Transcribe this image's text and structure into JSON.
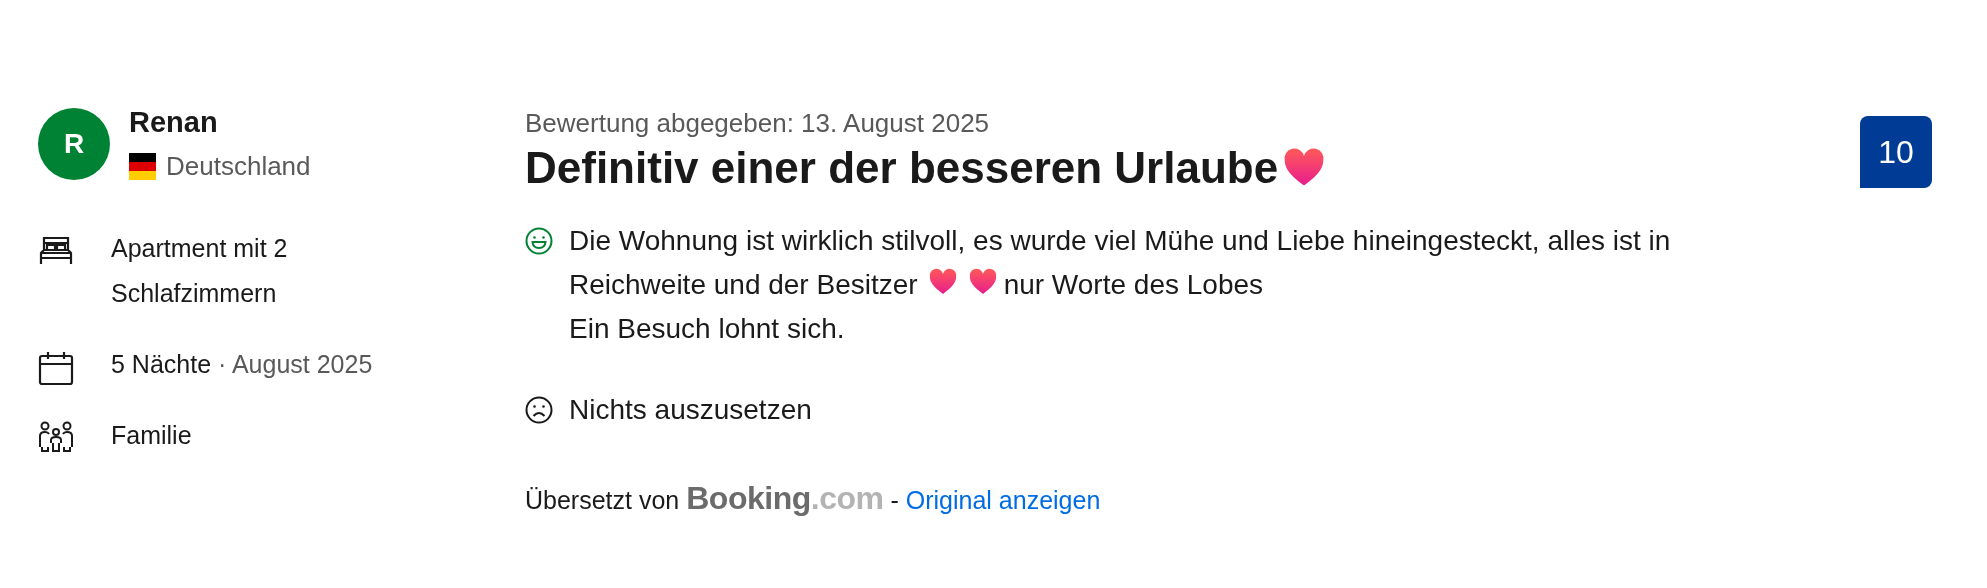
{
  "guest": {
    "initial": "R",
    "name": "Renan",
    "country": "Deutschland"
  },
  "stay": [
    {
      "kind": "room",
      "text": "Apartment mit 2 Schlafzimmern"
    },
    {
      "kind": "nights",
      "text": "5 Nächte",
      "separator": "·",
      "date": "August 2025"
    },
    {
      "kind": "group",
      "text": "Familie"
    }
  ],
  "review": {
    "date": "Bewertung abgegeben: 13. August 2025",
    "title": "Definitiv einer der besseren Urlaube",
    "title_heart": true,
    "positive": [
      [
        {
          "kind": "text",
          "text": "Die Wohnung ist wirklich stilvoll, es wurde viel Mühe und Liebe hineingesteckt, alles ist in"
        }
      ],
      [
        {
          "kind": "text",
          "text": "Reichweite und der Besitzer"
        },
        {
          "kind": "heart"
        },
        {
          "kind": "heart"
        },
        {
          "kind": "text",
          "text": "nur Worte des Lobes"
        }
      ],
      [
        {
          "kind": "text",
          "text": "Ein Besuch lohnt sich."
        }
      ]
    ],
    "negative": "Nichts auszusetzen",
    "translated": {
      "label": "Übersetzt von",
      "logo": {
        "name": "Booking",
        "suffix": ".com"
      },
      "separator": "-",
      "link": "Original anzeigen"
    }
  },
  "score": "10"
}
